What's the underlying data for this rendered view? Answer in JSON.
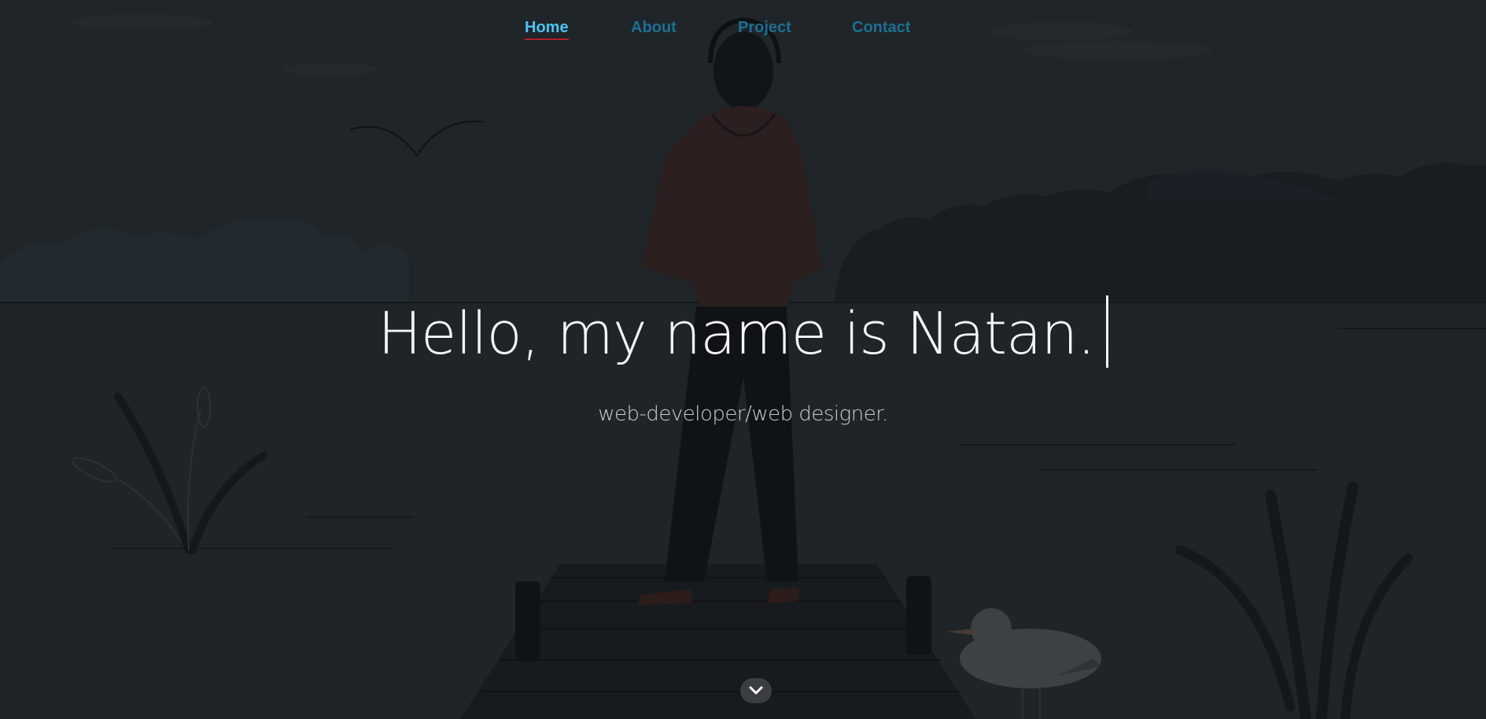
{
  "nav": {
    "items": [
      {
        "label": "Home",
        "active": true
      },
      {
        "label": "About",
        "active": false
      },
      {
        "label": "Project",
        "active": false
      },
      {
        "label": "Contact",
        "active": false
      }
    ]
  },
  "hero": {
    "headline": "Hello, my name is Natan.",
    "subtitle": "web-developer/web designer.",
    "scroll_icon": "chevron-down-icon"
  },
  "colors": {
    "background": "#1f2529",
    "nav_active": "#4cc3ef",
    "nav_inactive": "#1d6f93",
    "underline": "#b01e2a",
    "headline": "#f2f4f5"
  }
}
